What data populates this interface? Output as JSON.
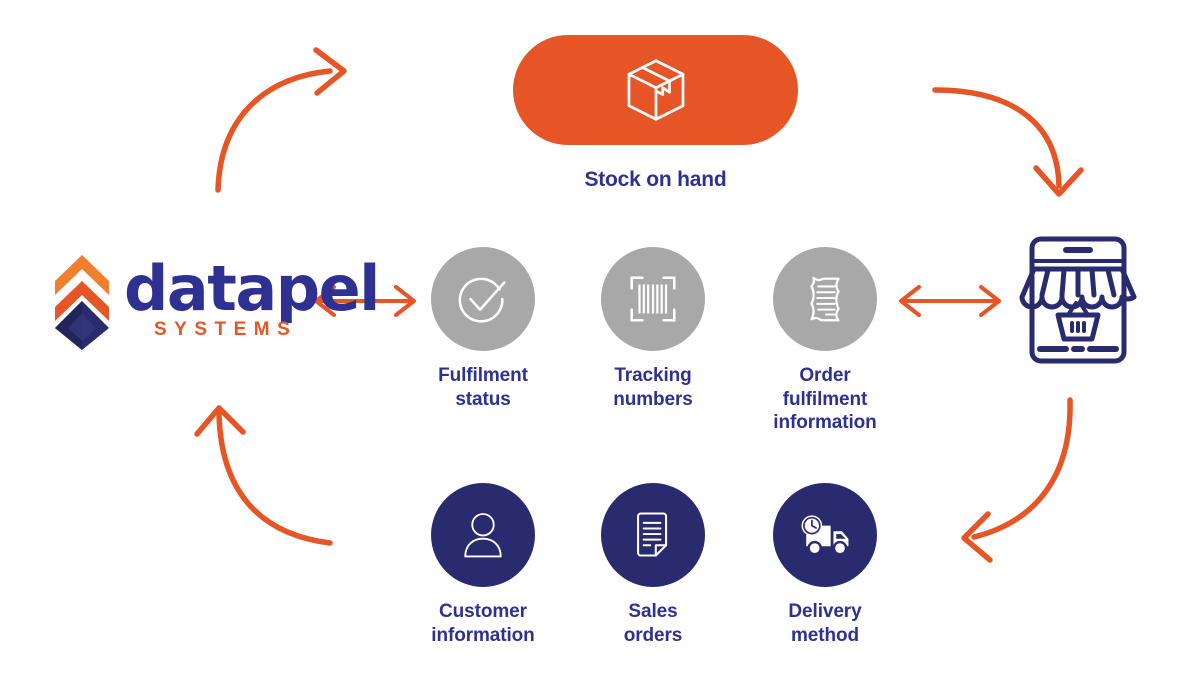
{
  "diagram": {
    "title": "Datapel Systems order fulfilment data flow",
    "colors": {
      "orange": "#E65525",
      "navy": "#2A2B6E",
      "label_blue": "#2E3192",
      "gray_circle": "#A8A8A8",
      "white": "#FFFFFF"
    }
  },
  "logo": {
    "name": "datapel",
    "subtitle": "SYSTEMS",
    "mark_icon": "datapel-chevron-diamond-icon"
  },
  "stock_node": {
    "label": "Stock on hand",
    "icon": "package-box-icon",
    "shape": "pill",
    "color": "#E65525"
  },
  "storefront_node": {
    "icon": "online-storefront-icon",
    "color": "#2A2B6E"
  },
  "nodes": [
    {
      "id": "fulfilment-status",
      "icon": "check-circle-icon",
      "circle_color": "#A8A8A8",
      "caption_lines": [
        "Fulfilment",
        "status"
      ]
    },
    {
      "id": "tracking-numbers",
      "icon": "barcode-scan-icon",
      "circle_color": "#A8A8A8",
      "caption_lines": [
        "Tracking",
        "numbers"
      ]
    },
    {
      "id": "order-fulfilment-information",
      "icon": "receipt-document-icon",
      "circle_color": "#A8A8A8",
      "caption_lines": [
        "Order",
        "fulfilment",
        "information"
      ]
    },
    {
      "id": "customer-information",
      "icon": "user-person-icon",
      "circle_color": "#2A2B6E",
      "caption_lines": [
        "Customer",
        "information"
      ]
    },
    {
      "id": "sales-orders",
      "icon": "document-page-icon",
      "circle_color": "#2A2B6E",
      "caption_lines": [
        "Sales",
        "orders"
      ]
    },
    {
      "id": "delivery-method",
      "icon": "delivery-truck-clock-icon",
      "circle_color": "#2A2B6E",
      "caption_lines": [
        "Delivery",
        "method"
      ]
    }
  ],
  "connectors": [
    {
      "id": "curve-top-left",
      "icon": "curved-arrow-up-right-icon",
      "direction": "up-right",
      "color": "#E65525"
    },
    {
      "id": "curve-top-right",
      "icon": "curved-arrow-down-right-icon",
      "direction": "down-right",
      "color": "#E65525"
    },
    {
      "id": "curve-bottom-right",
      "icon": "curved-arrow-down-left-icon",
      "direction": "down-left",
      "color": "#E65525"
    },
    {
      "id": "curve-bottom-left",
      "icon": "curved-arrow-up-left-icon",
      "direction": "up-left",
      "color": "#E65525"
    },
    {
      "id": "arrow-logo-to-nodes",
      "icon": "double-headed-arrow-icon",
      "direction": "bidirectional",
      "color": "#E65525"
    },
    {
      "id": "arrow-nodes-to-store",
      "icon": "double-headed-arrow-icon",
      "direction": "bidirectional",
      "color": "#E65525"
    }
  ]
}
